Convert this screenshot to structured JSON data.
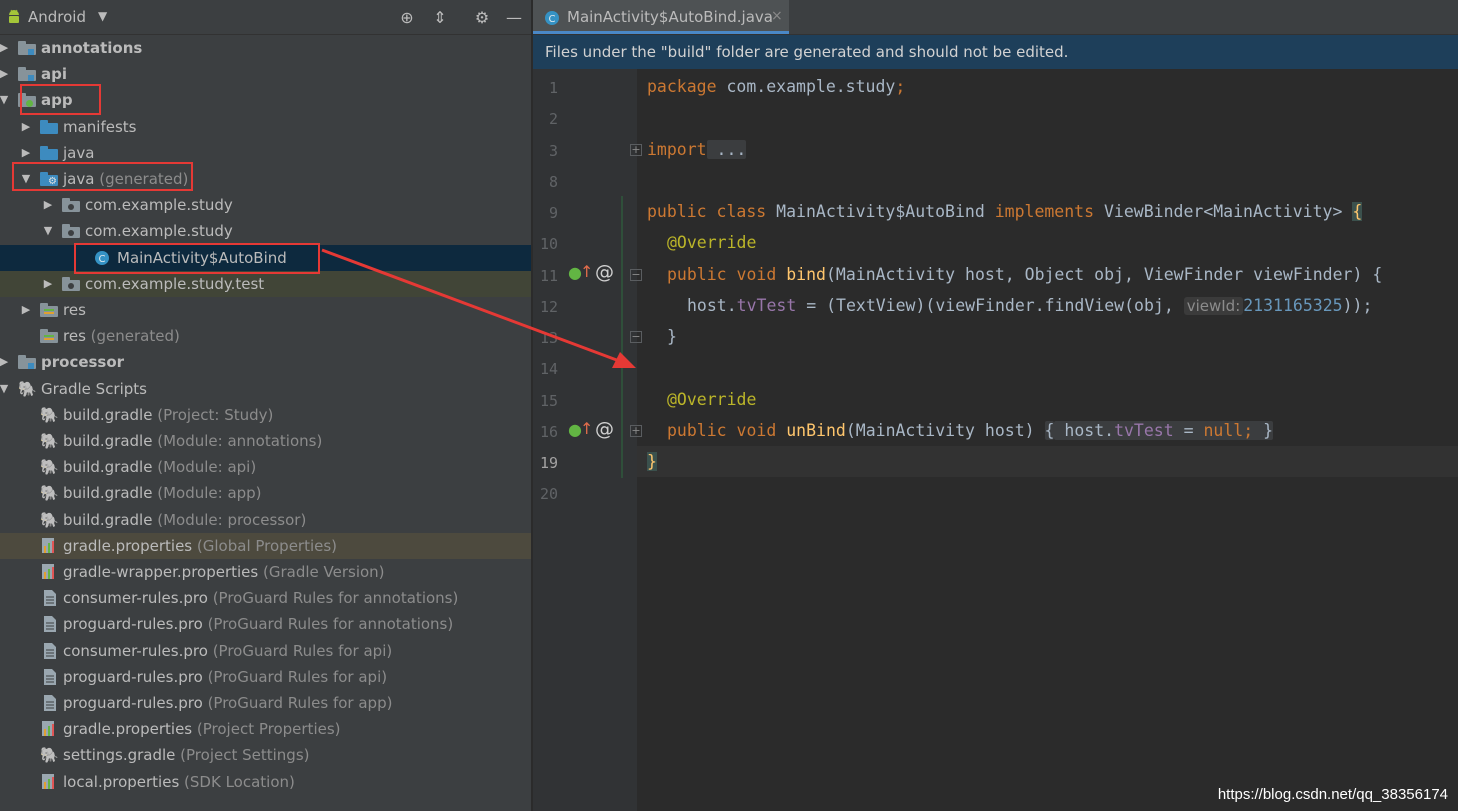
{
  "project_panel": {
    "view_name": "Android",
    "toolbar_icons": [
      "locate-icon",
      "collapse-all-icon",
      "gear-icon",
      "minimize-icon"
    ],
    "tree": [
      {
        "label": "annotations",
        "hint": "",
        "bold": true
      },
      {
        "label": "api",
        "hint": "",
        "bold": true
      },
      {
        "label": "app",
        "hint": "",
        "bold": true
      },
      {
        "label": "manifests",
        "hint": ""
      },
      {
        "label": "java",
        "hint": ""
      },
      {
        "label": "java",
        "hint": "(generated)"
      },
      {
        "label": "com.example.study",
        "hint": ""
      },
      {
        "label": "com.example.study",
        "hint": ""
      },
      {
        "label": "MainActivity$AutoBind",
        "hint": ""
      },
      {
        "label": "com.example.study.test",
        "hint": ""
      },
      {
        "label": "res",
        "hint": ""
      },
      {
        "label": "res",
        "hint": "(generated)"
      },
      {
        "label": "processor",
        "hint": "",
        "bold": true
      },
      {
        "label": "Gradle Scripts",
        "hint": ""
      },
      {
        "label": "build.gradle",
        "hint": "(Project: Study)"
      },
      {
        "label": "build.gradle",
        "hint": "(Module: annotations)"
      },
      {
        "label": "build.gradle",
        "hint": "(Module: api)"
      },
      {
        "label": "build.gradle",
        "hint": "(Module: app)"
      },
      {
        "label": "build.gradle",
        "hint": "(Module: processor)"
      },
      {
        "label": "gradle.properties",
        "hint": "(Global Properties)"
      },
      {
        "label": "gradle-wrapper.properties",
        "hint": "(Gradle Version)"
      },
      {
        "label": "consumer-rules.pro",
        "hint": "(ProGuard Rules for annotations)"
      },
      {
        "label": "proguard-rules.pro",
        "hint": "(ProGuard Rules for annotations)"
      },
      {
        "label": "consumer-rules.pro",
        "hint": "(ProGuard Rules for api)"
      },
      {
        "label": "proguard-rules.pro",
        "hint": "(ProGuard Rules for api)"
      },
      {
        "label": "proguard-rules.pro",
        "hint": "(ProGuard Rules for app)"
      },
      {
        "label": "gradle.properties",
        "hint": "(Project Properties)"
      },
      {
        "label": "settings.gradle",
        "hint": "(Project Settings)"
      },
      {
        "label": "local.properties",
        "hint": "(SDK Location)"
      }
    ]
  },
  "editor": {
    "tab_title": "MainActivity$AutoBind.java",
    "tab_close": "×",
    "tab_icon_letter": "C",
    "banner": "Files under the \"build\" folder are generated and should not be edited.",
    "line_numbers": [
      "1",
      "2",
      "3",
      "8",
      "9",
      "10",
      "11",
      "12",
      "13",
      "14",
      "15",
      "16",
      "19",
      "20"
    ],
    "code": {
      "l1_kw": "package",
      "l1_pkg": " com.example.study",
      "l1_semi": ";",
      "l3_kw": "import",
      "l3_fold": " ...",
      "l9_kw1": "public class",
      "l9_name": " MainActivity$AutoBind ",
      "l9_kw2": "implements",
      "l9_type": " ViewBinder<MainActivity> ",
      "l9_brace": "{",
      "l10_ann": "@Override",
      "l11_kw": "public void",
      "l11_fn": " bind",
      "l11_params": "(MainActivity host, Object obj, ViewFinder viewFinder) {",
      "l12_host": "host.",
      "l12_field": "tvTest",
      "l12_rest": " = (TextView)(viewFinder.findView(obj, ",
      "l12_hint": "viewId:",
      "l12_num": "2131165325",
      "l12_end": "));",
      "l13": "}",
      "l15_ann": "@Override",
      "l16_kw": "public void",
      "l16_fn": " unBind",
      "l16_params": "(MainActivity host) ",
      "l16_open": "{",
      "l16_host": " host.",
      "l16_field": "tvTest",
      "l16_eq": " = ",
      "l16_null": "null",
      "l16_semi": ";",
      "l16_close": " }",
      "l19": "}"
    }
  },
  "watermark": "https://blog.csdn.net/qq_38356174"
}
